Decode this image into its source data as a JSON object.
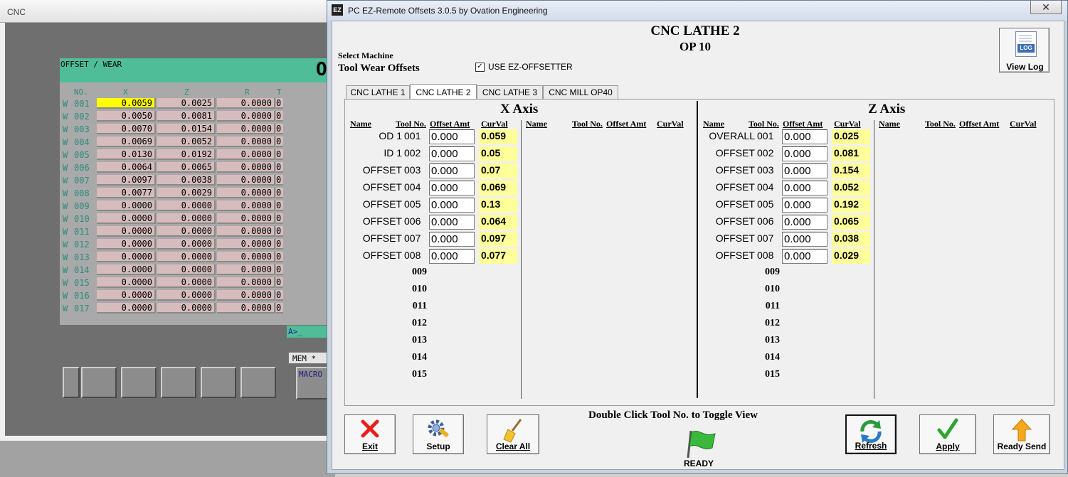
{
  "cnc_window": {
    "title": "CNC",
    "header": "OFFSET / WEAR",
    "header_glyph": "O",
    "columns": {
      "no": "NO.",
      "x": "X",
      "z": "Z",
      "r": "R",
      "t": "T"
    },
    "rows": [
      {
        "w": "W",
        "no": "001",
        "x": "0.0059",
        "z": "0.0025",
        "r": "0.0000",
        "t": "0"
      },
      {
        "w": "W",
        "no": "002",
        "x": "0.0050",
        "z": "0.0081",
        "r": "0.0000",
        "t": "0"
      },
      {
        "w": "W",
        "no": "003",
        "x": "0.0070",
        "z": "0.0154",
        "r": "0.0000",
        "t": "0"
      },
      {
        "w": "W",
        "no": "004",
        "x": "0.0069",
        "z": "0.0052",
        "r": "0.0000",
        "t": "0"
      },
      {
        "w": "W",
        "no": "005",
        "x": "0.0130",
        "z": "0.0192",
        "r": "0.0000",
        "t": "0"
      },
      {
        "w": "W",
        "no": "006",
        "x": "0.0064",
        "z": "0.0065",
        "r": "0.0000",
        "t": "0"
      },
      {
        "w": "W",
        "no": "007",
        "x": "0.0097",
        "z": "0.0038",
        "r": "0.0000",
        "t": "0"
      },
      {
        "w": "W",
        "no": "008",
        "x": "0.0077",
        "z": "0.0029",
        "r": "0.0000",
        "t": "0"
      },
      {
        "w": "W",
        "no": "009",
        "x": "0.0000",
        "z": "0.0000",
        "r": "0.0000",
        "t": "0"
      },
      {
        "w": "W",
        "no": "010",
        "x": "0.0000",
        "z": "0.0000",
        "r": "0.0000",
        "t": "0"
      },
      {
        "w": "W",
        "no": "011",
        "x": "0.0000",
        "z": "0.0000",
        "r": "0.0000",
        "t": "0"
      },
      {
        "w": "W",
        "no": "012",
        "x": "0.0000",
        "z": "0.0000",
        "r": "0.0000",
        "t": "0"
      },
      {
        "w": "W",
        "no": "013",
        "x": "0.0000",
        "z": "0.0000",
        "r": "0.0000",
        "t": "0"
      },
      {
        "w": "W",
        "no": "014",
        "x": "0.0000",
        "z": "0.0000",
        "r": "0.0000",
        "t": "0"
      },
      {
        "w": "W",
        "no": "015",
        "x": "0.0000",
        "z": "0.0000",
        "r": "0.0000",
        "t": "0"
      },
      {
        "w": "W",
        "no": "016",
        "x": "0.0000",
        "z": "0.0000",
        "r": "0.0000",
        "t": "0"
      },
      {
        "w": "W",
        "no": "017",
        "x": "0.0000",
        "z": "0.0000",
        "r": "0.0000",
        "t": "0"
      }
    ],
    "prompt": "A>_",
    "mode": "MEM  *",
    "macro_key": "MACRO"
  },
  "ez_window": {
    "title": "PC EZ-Remote Offsets 3.0.5 by Ovation Engineering",
    "app_icon": "EZ",
    "close_glyph": "✕",
    "machine_title": "CNC LATHE 2",
    "operation": "OP 10",
    "select_machine_label": "Select Machine",
    "offset_type": "Tool Wear Offsets",
    "use_ez_offsetter": {
      "label": "USE EZ-OFFSETTER",
      "checked": true,
      "glyph": "✓"
    },
    "view_log": {
      "label": "View Log",
      "icon_text": "LOG"
    },
    "tabs": [
      {
        "label": "CNC LATHE 1",
        "active": false
      },
      {
        "label": "CNC LATHE 2",
        "active": true
      },
      {
        "label": "CNC LATHE 3",
        "active": false
      },
      {
        "label": "CNC MILL OP40",
        "active": false
      }
    ],
    "column_headers": {
      "name": "Name",
      "tool_no": "Tool No.",
      "offset_amt": "Offset Amt",
      "curval": "CurVal"
    },
    "x_axis": {
      "title": "X Axis",
      "rows": [
        {
          "name": "OD 1",
          "tool": "001",
          "offset": "0.000",
          "curval": "0.059"
        },
        {
          "name": "ID 1",
          "tool": "002",
          "offset": "0.000",
          "curval": "0.05"
        },
        {
          "name": "OFFSET",
          "tool": "003",
          "offset": "0.000",
          "curval": "0.07"
        },
        {
          "name": "OFFSET",
          "tool": "004",
          "offset": "0.000",
          "curval": "0.069"
        },
        {
          "name": "OFFSET",
          "tool": "005",
          "offset": "0.000",
          "curval": "0.13"
        },
        {
          "name": "OFFSET",
          "tool": "006",
          "offset": "0.000",
          "curval": "0.064"
        },
        {
          "name": "OFFSET",
          "tool": "007",
          "offset": "0.000",
          "curval": "0.097"
        },
        {
          "name": "OFFSET",
          "tool": "008",
          "offset": "0.000",
          "curval": "0.077"
        }
      ],
      "empty_tools": [
        "009",
        "010",
        "011",
        "012",
        "013",
        "014",
        "015"
      ]
    },
    "z_axis": {
      "title": "Z Axis",
      "rows": [
        {
          "name": "OVERALL",
          "tool": "001",
          "offset": "0.000",
          "curval": "0.025"
        },
        {
          "name": "OFFSET",
          "tool": "002",
          "offset": "0.000",
          "curval": "0.081"
        },
        {
          "name": "OFFSET",
          "tool": "003",
          "offset": "0.000",
          "curval": "0.154"
        },
        {
          "name": "OFFSET",
          "tool": "004",
          "offset": "0.000",
          "curval": "0.052"
        },
        {
          "name": "OFFSET",
          "tool": "005",
          "offset": "0.000",
          "curval": "0.192"
        },
        {
          "name": "OFFSET",
          "tool": "006",
          "offset": "0.000",
          "curval": "0.065"
        },
        {
          "name": "OFFSET",
          "tool": "007",
          "offset": "0.000",
          "curval": "0.038"
        },
        {
          "name": "OFFSET",
          "tool": "008",
          "offset": "0.000",
          "curval": "0.029"
        }
      ],
      "empty_tools": [
        "009",
        "010",
        "011",
        "012",
        "013",
        "014",
        "015"
      ]
    },
    "buttons": {
      "exit": "Exit",
      "setup": "Setup",
      "clear_all": "Clear All",
      "refresh": "Refresh",
      "apply": "Apply",
      "ready_send": "Ready Send"
    },
    "hint": "Double Click Tool No. to Toggle View",
    "status": "READY",
    "colors": {
      "curval_bg": "#ffff99",
      "cnc_header": "#4fbd98",
      "cnc_selected": "#ffff00",
      "exit_x": "#e8201a",
      "apply_check": "#2fa52f",
      "flag": "#3cb83c"
    }
  }
}
